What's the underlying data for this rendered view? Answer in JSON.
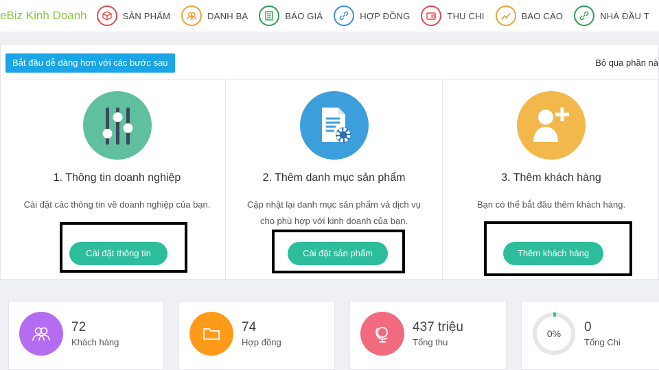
{
  "topbar": {
    "brand": "eBiz Kinh Doanh",
    "items": [
      {
        "label": "SẢN PHẨM",
        "color": "#e04b4b"
      },
      {
        "label": "DANH BẠ",
        "color": "#f0a030"
      },
      {
        "label": "BÁO GIÁ",
        "color": "#2e9e4f"
      },
      {
        "label": "HỢP ĐỒNG",
        "color": "#3a8fd8"
      },
      {
        "label": "THU CHI",
        "color": "#e04b4b"
      },
      {
        "label": "BÁO CÁO",
        "color": "#f0a030"
      },
      {
        "label": "NHÀ ĐẦU T",
        "color": "#2e9e4f"
      }
    ]
  },
  "onboarding": {
    "badge": "Bắt đầu dễ dàng hơn với các bước sau",
    "skip": "Bỏ qua phần nà",
    "cards": [
      {
        "title": "1. Thông tin doanh nghiệp",
        "desc": "Cài đặt các thông tin về doanh nghiệp của bạn.",
        "button": "Cài đặt thông tin",
        "color": "#5fbf9f"
      },
      {
        "title": "2. Thêm danh mục sản phẩm",
        "desc": "Cập nhật lại danh mục sản phẩm và dịch vụ cho phù hợp với kinh doanh của bạn.",
        "button": "Cài đặt sản phẩm",
        "color": "#3c9fdc"
      },
      {
        "title": "3. Thêm khách hàng",
        "desc": "Bạn có thể bắt đầu thêm khách hàng.",
        "button": "Thêm khách hàng",
        "color": "#f2b84b"
      }
    ]
  },
  "stats": [
    {
      "value": "72",
      "label": "Khách hàng",
      "color": "#b46df0"
    },
    {
      "value": "74",
      "label": "Hợp đồng",
      "color": "#ff9a1a"
    },
    {
      "value": "437 triệu",
      "label": "Tổng thu",
      "color": "#f16a7e"
    },
    {
      "value": "0",
      "label": "Tổng Chi",
      "ring_text": "0%",
      "ring_color": "#2ecc71"
    }
  ]
}
